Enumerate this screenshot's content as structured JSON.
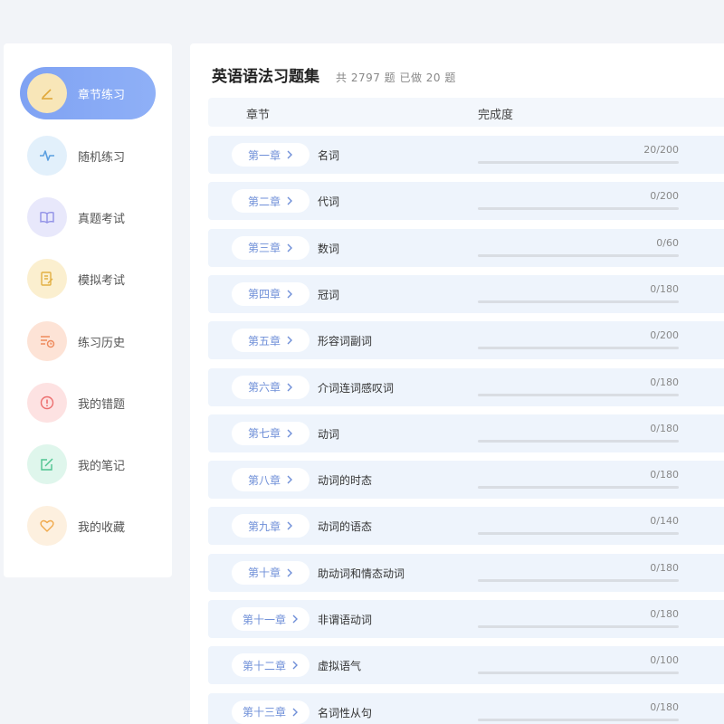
{
  "sidebar": {
    "items": [
      {
        "label": "章节练习",
        "icon": "pen-icon",
        "active": true,
        "icon_bg": "#f8e6b8",
        "icon_color": "#e0a83a"
      },
      {
        "label": "随机练习",
        "icon": "pulse-icon",
        "active": false,
        "icon_bg": "#e2f0fb",
        "icon_color": "#5b9fe0"
      },
      {
        "label": "真题考试",
        "icon": "book-icon",
        "active": false,
        "icon_bg": "#e8e8fb",
        "icon_color": "#8f8fe6"
      },
      {
        "label": "模拟考试",
        "icon": "note-icon",
        "active": false,
        "icon_bg": "#fbefcf",
        "icon_color": "#e2b043"
      },
      {
        "label": "练习历史",
        "icon": "history-icon",
        "active": false,
        "icon_bg": "#fde3d6",
        "icon_color": "#ee8a5c"
      },
      {
        "label": "我的错题",
        "icon": "alert-icon",
        "active": false,
        "icon_bg": "#fde2e2",
        "icon_color": "#ec6e6e"
      },
      {
        "label": "我的笔记",
        "icon": "edit-note-icon",
        "active": false,
        "icon_bg": "#dff6ec",
        "icon_color": "#4fc390"
      },
      {
        "label": "我的收藏",
        "icon": "heart-icon",
        "active": false,
        "icon_bg": "#fdf0df",
        "icon_color": "#f0a94b"
      }
    ]
  },
  "main": {
    "title": "英语语法习题集",
    "stats": "共 2797 题 已做 20 题",
    "header": {
      "chapter": "章节",
      "progress": "完成度"
    },
    "rows": [
      {
        "chapter": "第一章",
        "name": "名词",
        "count": "20/200",
        "progress": 0.1
      },
      {
        "chapter": "第二章",
        "name": "代词",
        "count": "0/200",
        "progress": 0
      },
      {
        "chapter": "第三章",
        "name": "数词",
        "count": "0/60",
        "progress": 0
      },
      {
        "chapter": "第四章",
        "name": "冠词",
        "count": "0/180",
        "progress": 0
      },
      {
        "chapter": "第五章",
        "name": "形容词副词",
        "count": "0/200",
        "progress": 0
      },
      {
        "chapter": "第六章",
        "name": "介词连词感叹词",
        "count": "0/180",
        "progress": 0
      },
      {
        "chapter": "第七章",
        "name": "动词",
        "count": "0/180",
        "progress": 0
      },
      {
        "chapter": "第八章",
        "name": "动词的时态",
        "count": "0/180",
        "progress": 0
      },
      {
        "chapter": "第九章",
        "name": "动词的语态",
        "count": "0/140",
        "progress": 0
      },
      {
        "chapter": "第十章",
        "name": "助动词和情态动词",
        "count": "0/180",
        "progress": 0
      },
      {
        "chapter": "第十一章",
        "name": "非谓语动词",
        "count": "0/180",
        "progress": 0
      },
      {
        "chapter": "第十二章",
        "name": "虚拟语气",
        "count": "0/100",
        "progress": 0
      },
      {
        "chapter": "第十三章",
        "name": "名词性从句",
        "count": "0/180",
        "progress": 0
      }
    ]
  }
}
